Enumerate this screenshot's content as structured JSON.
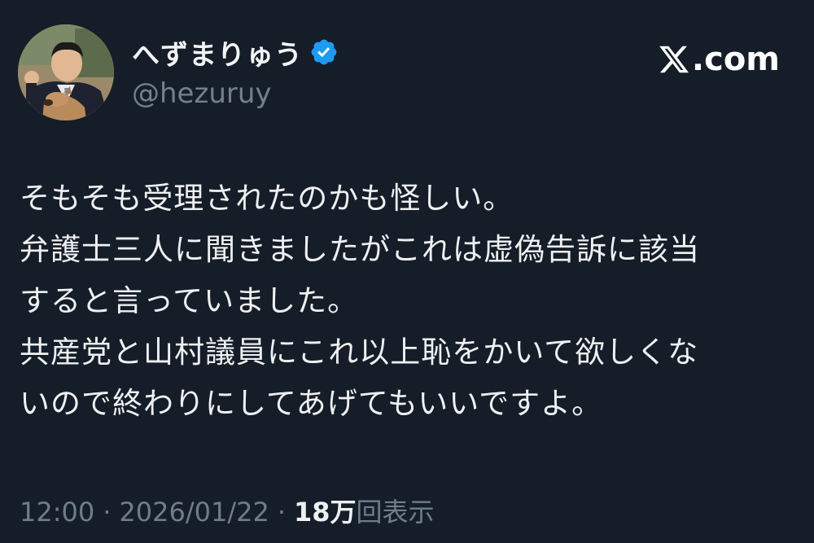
{
  "author": {
    "display_name": "へずまりゅう",
    "handle": "@hezuruy",
    "verified_icon": "verified-badge-icon",
    "avatar": "profile-photo"
  },
  "brand": {
    "icon": "x-logo-icon",
    "text": ".com"
  },
  "tweet": {
    "lines": [
      "そもそも受理されたのかも怪しい。",
      "弁護士三人に聞きましたがこれは虚偽告訴に該当",
      "すると言っていました。",
      "共産党と山村議員にこれ以上恥をかいて欲しくな",
      "いので終わりにしてあげてもいいですよ。"
    ]
  },
  "meta": {
    "time": "12:00",
    "separator": "·",
    "date": "2026/01/22",
    "views_count": "18万",
    "views_label": "回表示"
  },
  "colors": {
    "background": "#151d28",
    "text": "#eef0f1",
    "muted": "#71808f",
    "verified": "#1d9bf0"
  }
}
